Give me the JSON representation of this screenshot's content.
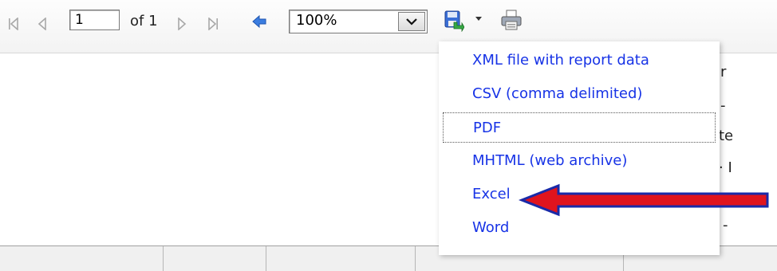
{
  "toolbar": {
    "current_page": "1",
    "page_total_label": "of 1",
    "zoom_value": "100%",
    "icons": {
      "first_page": "first-page-icon",
      "previous_page": "previous-page-icon",
      "next_page": "next-page-icon",
      "last_page": "last-page-icon",
      "back": "back-icon",
      "zoom_dropdown": "chevron-down-icon",
      "export": "export-save-icon",
      "export_dropdown": "caret-down-icon",
      "print": "printer-icon"
    }
  },
  "export_menu": {
    "items": [
      {
        "label": "XML file with report data"
      },
      {
        "label": "CSV (comma delimited)"
      },
      {
        "label": "PDF",
        "focused": true
      },
      {
        "label": "MHTML (web archive)"
      },
      {
        "label": "Excel"
      },
      {
        "label": "Word"
      }
    ]
  },
  "annotation": {
    "type": "red-arrow",
    "points_to": "Excel",
    "color": "#e0141e"
  },
  "report_peek": {
    "line1": "r",
    "line2": "-",
    "line3": "te",
    "line4": "· I",
    "line5": "-"
  },
  "colors": {
    "menu_text": "#1733e6",
    "arrow": "#e0141e",
    "arrow_outline": "#1a2aa8"
  }
}
